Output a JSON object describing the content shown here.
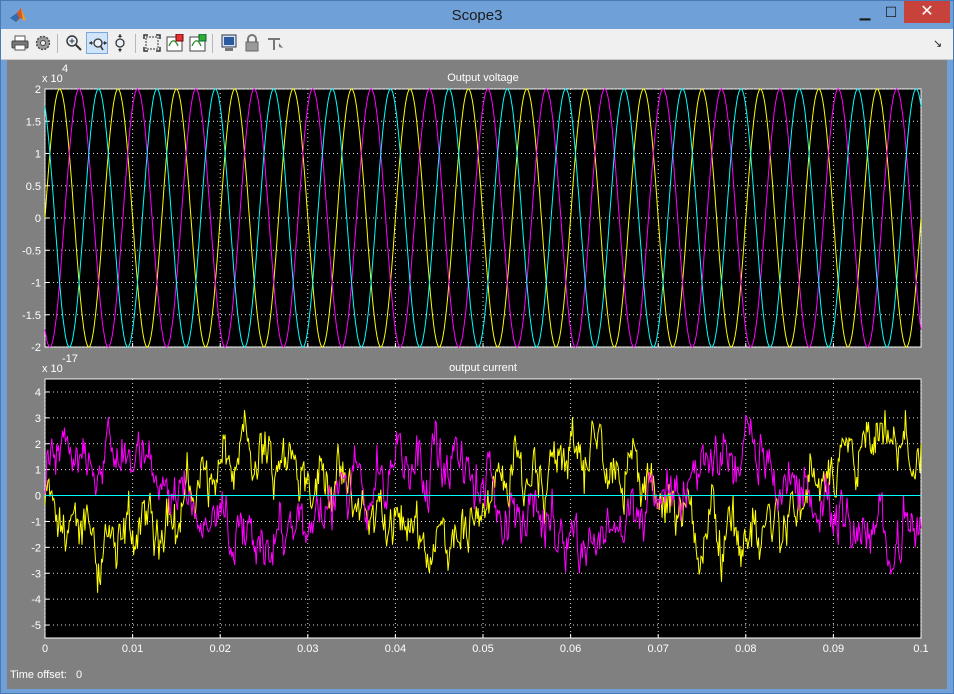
{
  "window": {
    "title": "Scope3",
    "min_glyph": "▁",
    "max_glyph": "☐",
    "close_glyph": "✕",
    "dock_glyph": "↘"
  },
  "toolbar": {
    "buttons": [
      {
        "name": "print-icon",
        "tooltip": "Print"
      },
      {
        "name": "parameters-icon",
        "tooltip": "Parameters"
      },
      {
        "name": "zoom-in-icon",
        "tooltip": "Zoom"
      },
      {
        "name": "zoom-x-icon",
        "tooltip": "Zoom X-axis",
        "active": true
      },
      {
        "name": "zoom-y-icon",
        "tooltip": "Zoom Y-axis"
      },
      {
        "name": "autoscale-icon",
        "tooltip": "Autoscale"
      },
      {
        "name": "save-axes-icon",
        "tooltip": "Save axes settings"
      },
      {
        "name": "restore-axes-icon",
        "tooltip": "Restore saved axes settings"
      },
      {
        "name": "floating-scope-icon",
        "tooltip": "Floating scope"
      },
      {
        "name": "lock-icon",
        "tooltip": "Lock axes selection"
      },
      {
        "name": "signal-selection-icon",
        "tooltip": "Signal selection"
      }
    ]
  },
  "status": {
    "time_offset_label": "Time offset:",
    "time_offset_value": "0"
  },
  "colors": {
    "background": "#808080",
    "axes": "#000000",
    "yellow": "#ffff00",
    "magenta": "#ff00ff",
    "cyan": "#00ffff"
  },
  "chart_data": [
    {
      "type": "line",
      "title": "Output voltage",
      "xlabel": "",
      "ylabel": "",
      "y_exponent": "x 10",
      "y_exponent_power": "4",
      "xlim": [
        0,
        0.1
      ],
      "ylim": [
        -2,
        2
      ],
      "yticks": [
        "2",
        "1.5",
        "1",
        "0.5",
        "0",
        "-0.5",
        "-1",
        "-1.5",
        "-2"
      ],
      "grid": true,
      "frequency_hz": 150,
      "amplitude": 2,
      "series": [
        {
          "color": "#ffff00",
          "phase_deg": 0
        },
        {
          "color": "#ff00ff",
          "phase_deg": -120
        },
        {
          "color": "#00ffff",
          "phase_deg": 120
        }
      ]
    },
    {
      "type": "line",
      "title": "output current",
      "xlabel": "",
      "ylabel": "",
      "y_exponent": "x 10",
      "y_exponent_power": "-17",
      "xlim": [
        0,
        0.1
      ],
      "ylim": [
        -5.5,
        4.5
      ],
      "yticks": [
        "4",
        "3",
        "2",
        "1",
        "0",
        "-1",
        "-2",
        "-3",
        "-4",
        "-5"
      ],
      "xticks": [
        "0",
        "0.01",
        "0.02",
        "0.03",
        "0.04",
        "0.05",
        "0.06",
        "0.07",
        "0.08",
        "0.09",
        "0.1"
      ],
      "grid": true,
      "series": [
        {
          "color": "#ffff00",
          "note": "numerical noise ~1e-17"
        },
        {
          "color": "#ff00ff",
          "note": "numerical noise ~1e-17"
        },
        {
          "color": "#00ffff",
          "values": "0"
        }
      ]
    }
  ]
}
